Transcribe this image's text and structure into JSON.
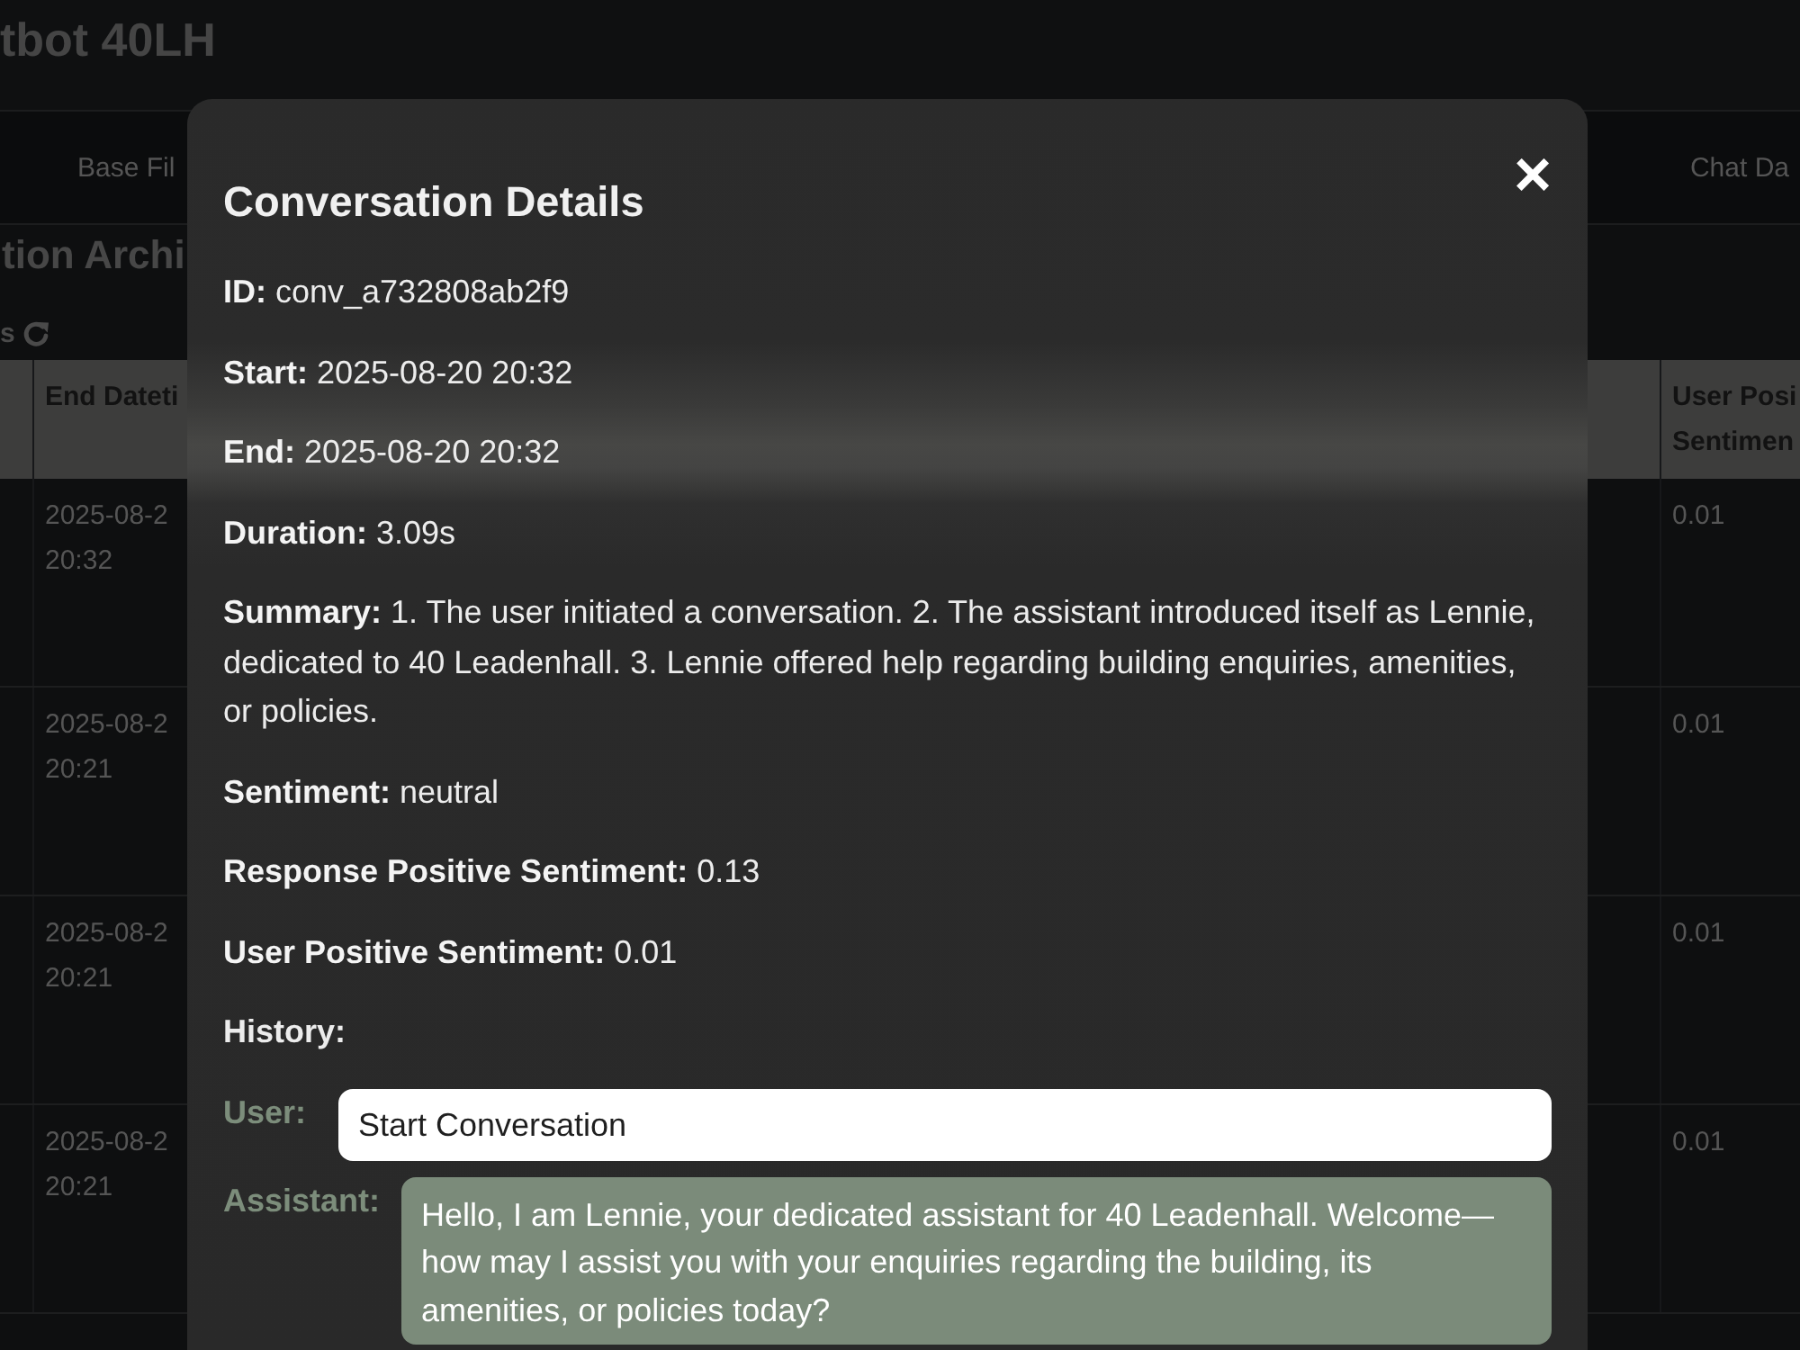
{
  "header": {
    "title": "tbot 40LH"
  },
  "nav": {
    "tabs": [
      {
        "label": "Base Fil"
      },
      {
        "label": "Chat Da"
      }
    ]
  },
  "page": {
    "heading": "tion Archi",
    "refresh_label": "s"
  },
  "table": {
    "columns": [
      "End Dateti",
      "User Posi\nSentimen"
    ],
    "rows": [
      {
        "cells": [
          "2025-08-2\n20:32",
          "0.01"
        ]
      },
      {
        "cells": [
          "2025-08-2\n20:21",
          "0.01"
        ]
      },
      {
        "cells": [
          "2025-08-2\n20:21",
          "0.01"
        ]
      },
      {
        "cells": [
          "2025-08-2\n20:21",
          "0.01"
        ]
      }
    ]
  },
  "modal": {
    "title": "Conversation Details",
    "close": "×",
    "details": [
      "**ID:** conv_a732808ab2f9",
      "**Start:** 2025-08-20 20:32",
      "**End:** 2025-08-20 20:32",
      "**Duration:** 3.09s",
      "**Summary:** 1. The user initiated a conversation. 2. The assistant introduced itself as Lennie, dedicated to 40 Leadenhall. 3. Lennie offered help regarding building enquiries, amenities, or policies.",
      "**Sentiment:** neutral",
      "**Response Positive Sentiment:** 0.13",
      "**User Positive Sentiment:** 0.01"
    ],
    "history_heading": "History:",
    "history": [
      {
        "kind": "user",
        "role": "User:",
        "text": "Start Conversation"
      },
      {
        "kind": "assistant",
        "role": "Assistant:",
        "text": "Hello, I am Lennie, your dedicated assistant for 40 Leadenhall. Welcome—how may I assist you with your enquiries regarding the building, its amenities, or policies today?"
      }
    ]
  }
}
